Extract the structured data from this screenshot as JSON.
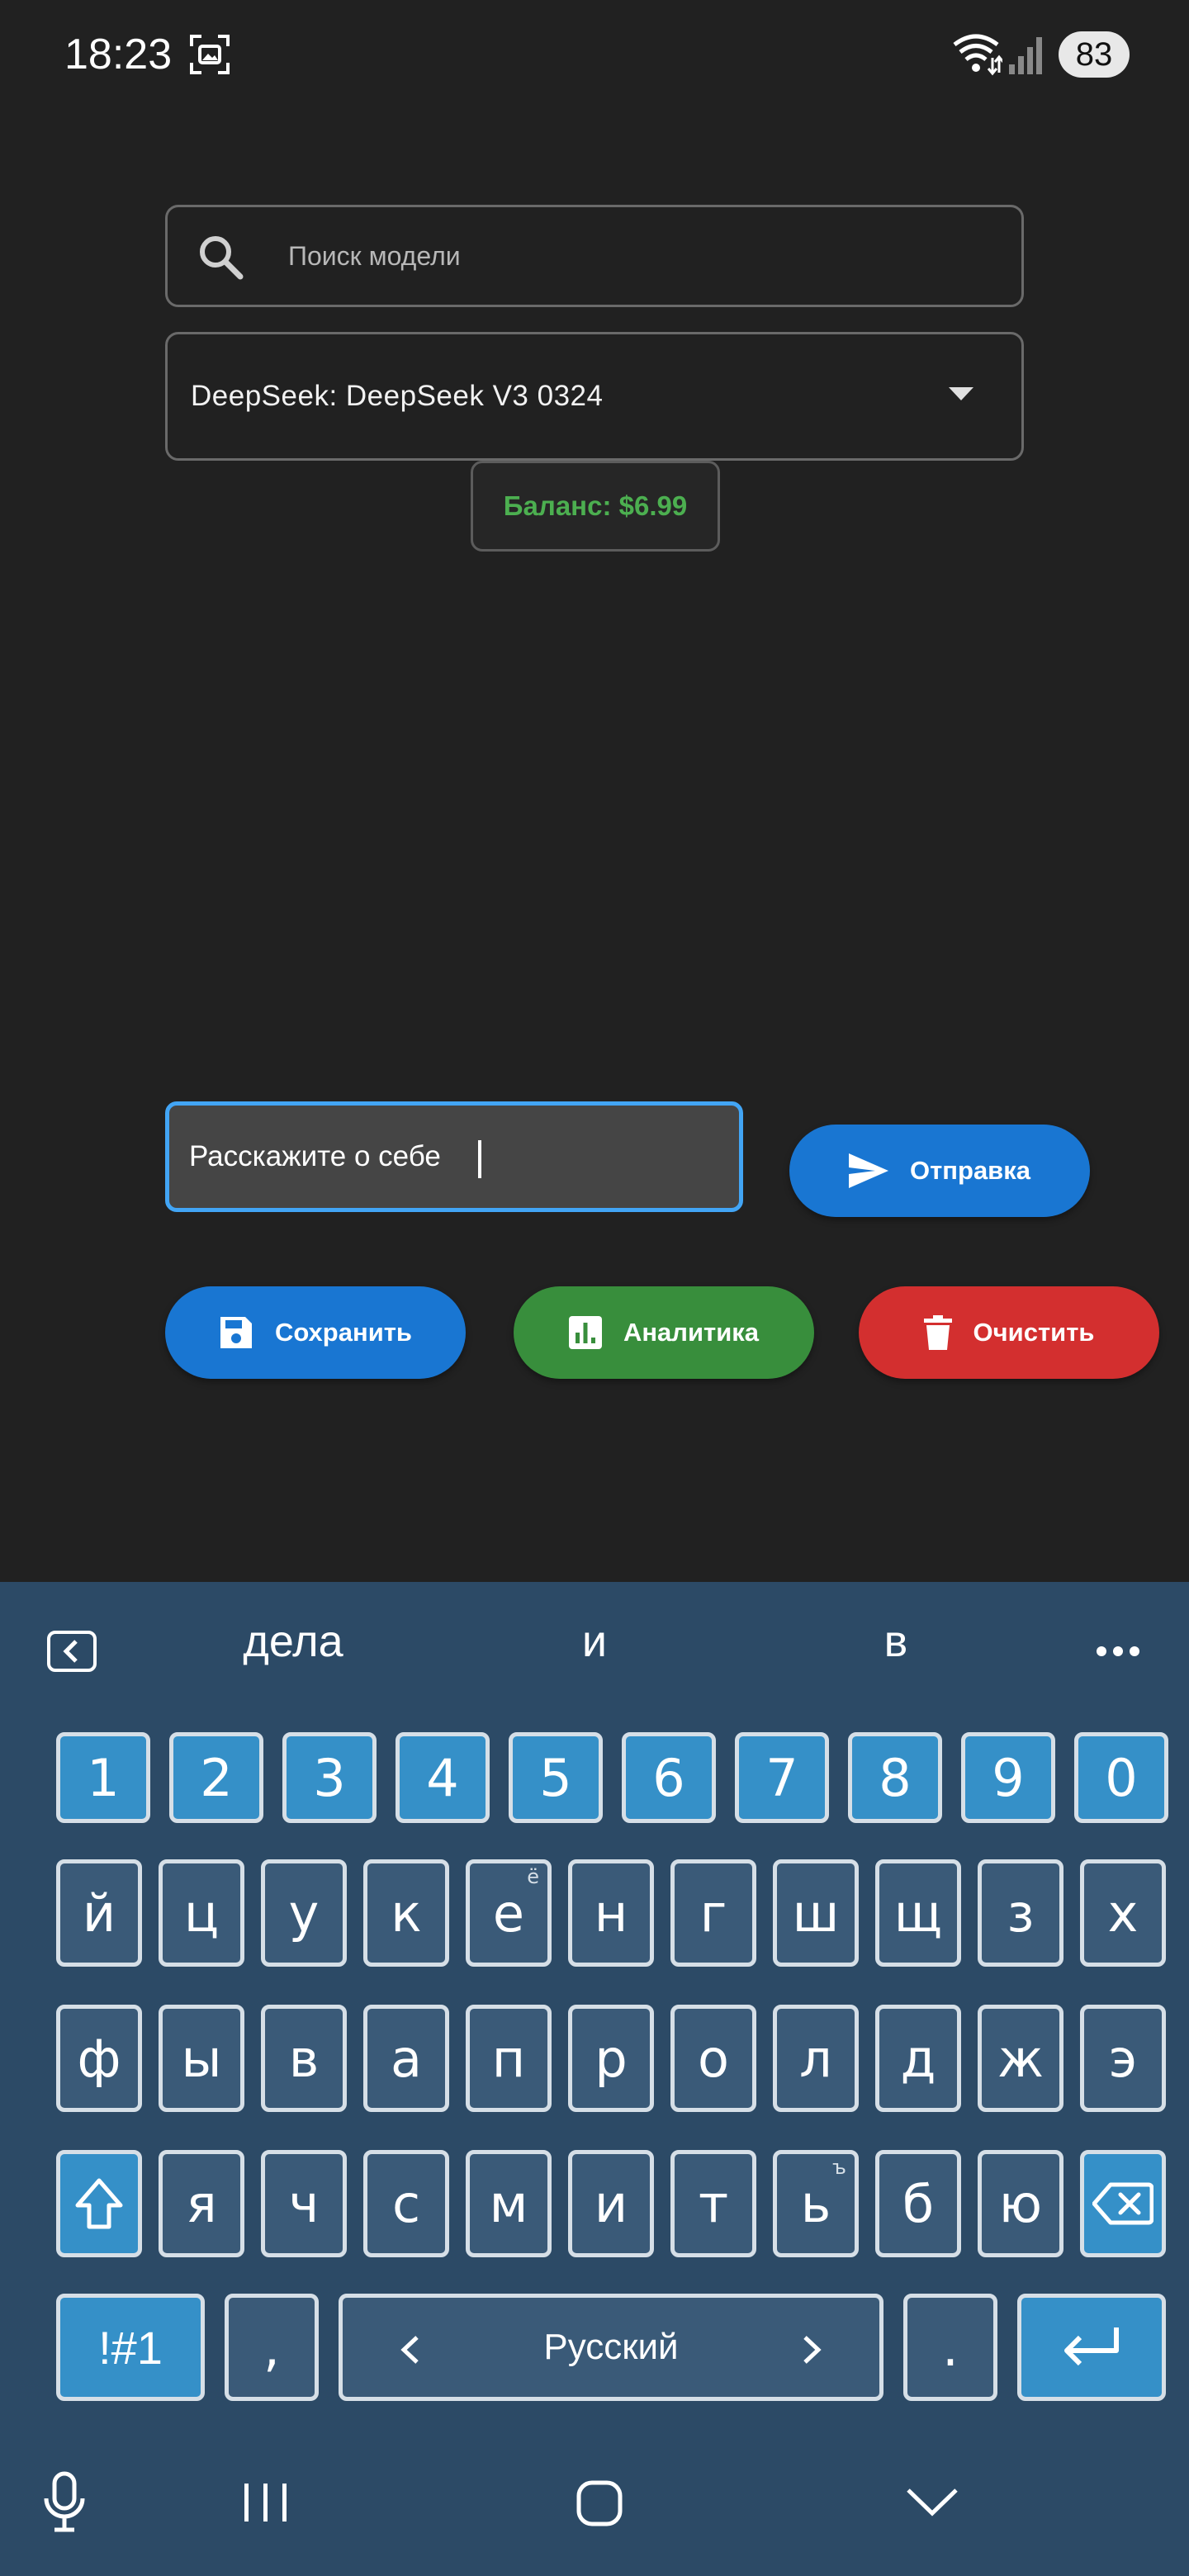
{
  "status_bar": {
    "time": "18:23",
    "battery": "83"
  },
  "search": {
    "placeholder": "Поиск модели"
  },
  "model_selector": {
    "selected": "DeepSeek: DeepSeek V3 0324"
  },
  "balance": {
    "label": "Баланс: $6.99"
  },
  "message_input": {
    "value": "Расскажите о себе"
  },
  "buttons": {
    "send": "Отправка",
    "save": "Сохранить",
    "analytics": "Аналитика",
    "clear": "Очистить"
  },
  "keyboard": {
    "suggestions": [
      "дела",
      "и",
      "в"
    ],
    "number_row": [
      "1",
      "2",
      "3",
      "4",
      "5",
      "6",
      "7",
      "8",
      "9",
      "0"
    ],
    "row1": [
      "й",
      "ц",
      "у",
      "к",
      "е",
      "н",
      "г",
      "ш",
      "щ",
      "з",
      "х"
    ],
    "row2": [
      "ф",
      "ы",
      "в",
      "а",
      "п",
      "р",
      "о",
      "л",
      "д",
      "ж",
      "э"
    ],
    "row3": [
      "я",
      "ч",
      "с",
      "м",
      "и",
      "т",
      "ь",
      "б",
      "ю"
    ],
    "hint_e": "ё",
    "hint_soft": "ъ",
    "symbols_key": "!#1",
    "comma_key": ",",
    "space_label": "Русский",
    "period_key": "."
  },
  "colors": {
    "background": "#212121",
    "accent_blue": "#1976d2",
    "accent_green": "#388e3c",
    "accent_red": "#d32f2f",
    "balance_green": "#4caf50",
    "keyboard_bg": "#2c4a66"
  }
}
